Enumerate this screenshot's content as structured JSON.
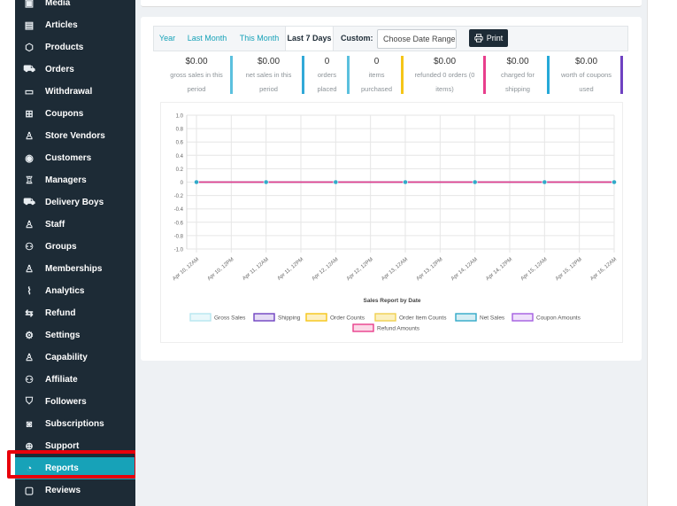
{
  "sidebar": {
    "items": [
      {
        "label": "Media",
        "icon": "media-icon",
        "glyph": "▣"
      },
      {
        "label": "Articles",
        "icon": "article-icon",
        "glyph": "▤"
      },
      {
        "label": "Products",
        "icon": "cube-icon",
        "glyph": "⬡"
      },
      {
        "label": "Orders",
        "icon": "cart-icon",
        "glyph": "⛟"
      },
      {
        "label": "Withdrawal",
        "icon": "card-icon",
        "glyph": "▭"
      },
      {
        "label": "Coupons",
        "icon": "gift-icon",
        "glyph": "⊞"
      },
      {
        "label": "Store Vendors",
        "icon": "user-icon",
        "glyph": "♙"
      },
      {
        "label": "Customers",
        "icon": "user-circle-icon",
        "glyph": "◉"
      },
      {
        "label": "Managers",
        "icon": "manager-icon",
        "glyph": "♖"
      },
      {
        "label": "Delivery Boys",
        "icon": "truck-icon",
        "glyph": "⛟"
      },
      {
        "label": "Staff",
        "icon": "staff-icon",
        "glyph": "♙"
      },
      {
        "label": "Groups",
        "icon": "group-icon",
        "glyph": "⚇"
      },
      {
        "label": "Memberships",
        "icon": "user-plus-icon",
        "glyph": "♙"
      },
      {
        "label": "Analytics",
        "icon": "chart-line-icon",
        "glyph": "⌇"
      },
      {
        "label": "Refund",
        "icon": "exchange-icon",
        "glyph": "⇆"
      },
      {
        "label": "Settings",
        "icon": "cogs-icon",
        "glyph": "⚙"
      },
      {
        "label": "Capability",
        "icon": "user-cog-icon",
        "glyph": "♙"
      },
      {
        "label": "Affiliate",
        "icon": "users-icon",
        "glyph": "⚇"
      },
      {
        "label": "Followers",
        "icon": "tshirt-icon",
        "glyph": "⛉"
      },
      {
        "label": "Subscriptions",
        "icon": "money-icon",
        "glyph": "◙"
      },
      {
        "label": "Support",
        "icon": "lifebuoy-icon",
        "glyph": "⊕"
      },
      {
        "label": "Reports",
        "icon": "pie-chart-icon",
        "glyph": "◔"
      },
      {
        "label": "Reviews",
        "icon": "comment-icon",
        "glyph": "▢"
      }
    ],
    "active": "Reports"
  },
  "tabs": [
    {
      "label": "Year"
    },
    {
      "label": "Last Month"
    },
    {
      "label": "This Month"
    },
    {
      "label": "Last 7 Days"
    }
  ],
  "active_tab": "Last 7 Days",
  "custom_label": "Custom:",
  "date_range_placeholder": "Choose Date Range",
  "print_label": "Print",
  "stats": [
    {
      "value": "$0.00",
      "desc1": "gross sales in this",
      "desc2": "period",
      "color": "#5bc0de"
    },
    {
      "value": "$0.00",
      "desc1": "net sales in this",
      "desc2": "period",
      "color": "#31a9d8"
    },
    {
      "value": "0",
      "desc1": "orders",
      "desc2": "placed",
      "color": "#5bc0de"
    },
    {
      "value": "0",
      "desc1": "items",
      "desc2": "purchased",
      "color": "#f5c518"
    },
    {
      "value": "$0.00",
      "desc1": "refunded 0 orders (0",
      "desc2": "items)",
      "color": "#e83e8c"
    },
    {
      "value": "$0.00",
      "desc1": "charged for",
      "desc2": "shipping",
      "color": "#26a9d8"
    },
    {
      "value": "$0.00",
      "desc1": "worth of coupons",
      "desc2": "used",
      "color": "#6f42c1"
    }
  ],
  "chart_data": {
    "type": "line",
    "title": "Sales Report by Date",
    "xlabel": "",
    "ylabel": "",
    "ylim": [
      -1.0,
      1.0
    ],
    "yticks": [
      "1.0",
      "0.8",
      "0.6",
      "0.4",
      "0.2",
      "0",
      "-0.2",
      "-0.4",
      "-0.6",
      "-0.8",
      "-1.0"
    ],
    "categories": [
      "Apr 10, 12AM",
      "Apr 10, 12PM",
      "Apr 11, 12AM",
      "Apr 11, 12PM",
      "Apr 12, 12AM",
      "Apr 12, 12PM",
      "Apr 13, 12AM",
      "Apr 13, 12PM",
      "Apr 14, 12AM",
      "Apr 14, 12PM",
      "Apr 15, 12AM",
      "Apr 15, 12PM",
      "Apr 16, 12AM"
    ],
    "grid": true,
    "legend_position": "bottom",
    "series": [
      {
        "name": "Gross Sales",
        "color": "#b7e7f0",
        "fill": "#e9f8fb",
        "values": [
          0,
          0,
          0,
          0,
          0,
          0,
          0,
          0,
          0,
          0,
          0,
          0,
          0
        ]
      },
      {
        "name": "Shipping",
        "color": "#6f42c1",
        "fill": "#e5dcf5",
        "values": [
          0,
          0,
          0,
          0,
          0,
          0,
          0,
          0,
          0,
          0,
          0,
          0,
          0
        ]
      },
      {
        "name": "Order Counts",
        "color": "#f5c518",
        "fill": "#fdf0c2",
        "values": [
          0,
          0,
          0,
          0,
          0,
          0,
          0,
          0,
          0,
          0,
          0,
          0,
          0
        ]
      },
      {
        "name": "Order Item Counts",
        "color": "#f0d050",
        "fill": "#fbf0bf",
        "values": [
          0,
          0,
          0,
          0,
          0,
          0,
          0,
          0,
          0,
          0,
          0,
          0,
          0
        ]
      },
      {
        "name": "Net Sales",
        "color": "#31a9c8",
        "fill": "#d6eef4",
        "values": [
          0,
          0,
          0,
          0,
          0,
          0,
          0,
          0,
          0,
          0,
          0,
          0,
          0
        ]
      },
      {
        "name": "Coupon Amounts",
        "color": "#a45de0",
        "fill": "#efe1fb",
        "values": [
          0,
          0,
          0,
          0,
          0,
          0,
          0,
          0,
          0,
          0,
          0,
          0,
          0
        ]
      },
      {
        "name": "Refund Amounts",
        "color": "#e83e8c",
        "fill": "#fbd9e7",
        "values": [
          0,
          0,
          0,
          0,
          0,
          0,
          0,
          0,
          0,
          0,
          0,
          0,
          0
        ]
      }
    ]
  }
}
